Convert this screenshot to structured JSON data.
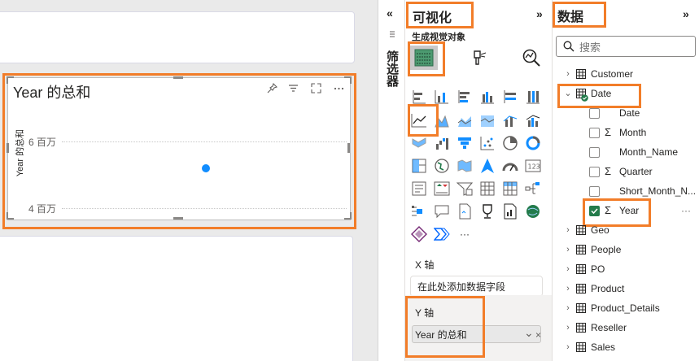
{
  "canvas": {
    "visual": {
      "title": "Year 的总和",
      "y_axis_title": "Year 的总和",
      "y_ticks": [
        "6 百万",
        "4 百万"
      ]
    }
  },
  "filters_pane": {
    "label": "筛选器",
    "collapse_glyph": "«"
  },
  "visualizations_pane": {
    "title": "可视化",
    "collapse_glyph": "»",
    "subtitle": "生成视觉对象",
    "more_glyph": "···",
    "x_axis": {
      "label": "X 轴",
      "placeholder": "在此处添加数据字段"
    },
    "y_axis": {
      "label": "Y 轴",
      "field": "Year 的总和",
      "close_glyph": "×",
      "dropdown_glyph": "⌄"
    }
  },
  "data_pane": {
    "title": "数据",
    "collapse_glyph": "»",
    "search_placeholder": "搜索",
    "tables": [
      {
        "name": "Customer",
        "expanded": false
      },
      {
        "name": "Date",
        "expanded": true,
        "fields": [
          {
            "name": "Date",
            "sigma": false,
            "checked": false
          },
          {
            "name": "Month",
            "sigma": true,
            "checked": false
          },
          {
            "name": "Month_Name",
            "sigma": false,
            "checked": false
          },
          {
            "name": "Quarter",
            "sigma": true,
            "checked": false
          },
          {
            "name": "Short_Month_N...",
            "sigma": false,
            "checked": false
          },
          {
            "name": "Year",
            "sigma": true,
            "checked": true
          }
        ]
      },
      {
        "name": "Geo",
        "expanded": false
      },
      {
        "name": "People",
        "expanded": false
      },
      {
        "name": "PO",
        "expanded": false
      },
      {
        "name": "Product",
        "expanded": false
      },
      {
        "name": "Product_Details",
        "expanded": false
      },
      {
        "name": "Reseller",
        "expanded": false
      },
      {
        "name": "Sales",
        "expanded": false
      }
    ],
    "field_more_glyph": "···"
  },
  "colors": {
    "highlight": "#f27d29",
    "data_point": "#118dff",
    "checked": "#237b4b"
  }
}
